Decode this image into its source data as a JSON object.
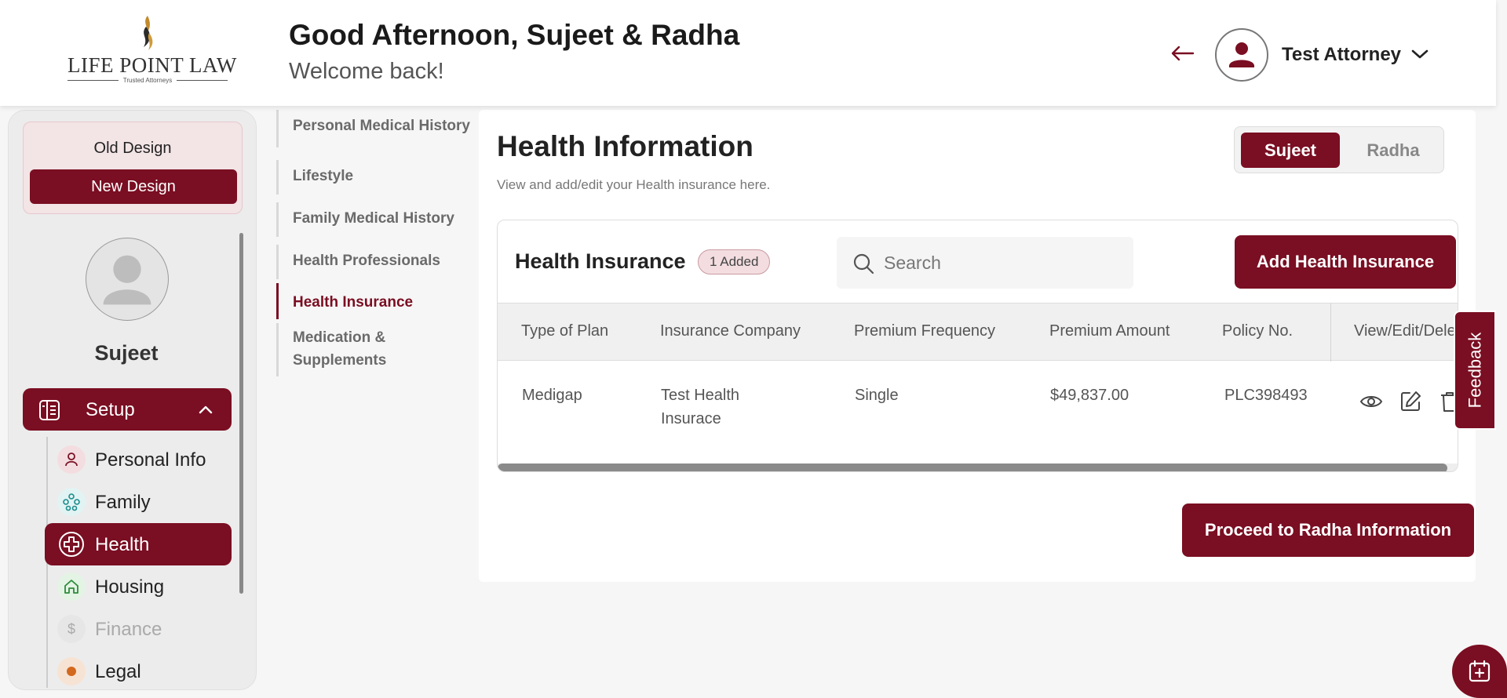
{
  "brand": {
    "name": "LIFE POINT LAW",
    "tagline": "Trusted Attorneys"
  },
  "header": {
    "greeting": "Good Afternoon, Sujeet & Radha",
    "welcome": "Welcome back!",
    "user_name": "Test Attorney"
  },
  "design_switch": {
    "old_label": "Old Design",
    "new_label": "New Design"
  },
  "profile": {
    "name": "Sujeet"
  },
  "sidebar": {
    "section_label": "Setup",
    "items": [
      {
        "label": "Personal Info",
        "icon": "person-icon",
        "state": "normal"
      },
      {
        "label": "Family",
        "icon": "family-icon",
        "state": "normal"
      },
      {
        "label": "Health",
        "icon": "health-plus-icon",
        "state": "active"
      },
      {
        "label": "Housing",
        "icon": "house-icon",
        "state": "normal"
      },
      {
        "label": "Finance",
        "icon": "dollar-icon",
        "state": "disabled"
      },
      {
        "label": "Legal",
        "icon": "legal-icon",
        "state": "normal"
      }
    ]
  },
  "subnav": {
    "items": [
      {
        "label": "Personal Medical History",
        "active": false
      },
      {
        "label": "Lifestyle",
        "active": false
      },
      {
        "label": "Family Medical History",
        "active": false
      },
      {
        "label": "Health Professionals",
        "active": false
      },
      {
        "label": "Health Insurance",
        "active": true
      },
      {
        "label_line1": "Medication &",
        "label_line2": "Supplements",
        "active": false
      }
    ]
  },
  "main": {
    "title": "Health Information",
    "subtitle": "View and add/edit your Health insurance here.",
    "person_toggle": {
      "selected": "Sujeet",
      "other": "Radha"
    },
    "card": {
      "title": "Health Insurance",
      "badge": "1 Added",
      "search_placeholder": "Search",
      "add_button": "Add Health Insurance",
      "columns": [
        "Type of Plan",
        "Insurance Company",
        "Premium Frequency",
        "Premium Amount",
        "Policy No.",
        "View/Edit/Dele"
      ],
      "rows": [
        {
          "type_of_plan": "Medigap",
          "company_line1": "Test Health",
          "company_line2": "Insurace",
          "frequency": "Single",
          "amount": "$49,837.00",
          "policy_no": "PLC398493"
        }
      ]
    },
    "proceed_button": "Proceed to Radha Information"
  },
  "feedback_label": "Feedback",
  "colors": {
    "brand": "#7a0e22",
    "brand_light": "#f3dde0",
    "background": "#f6f6f6"
  }
}
